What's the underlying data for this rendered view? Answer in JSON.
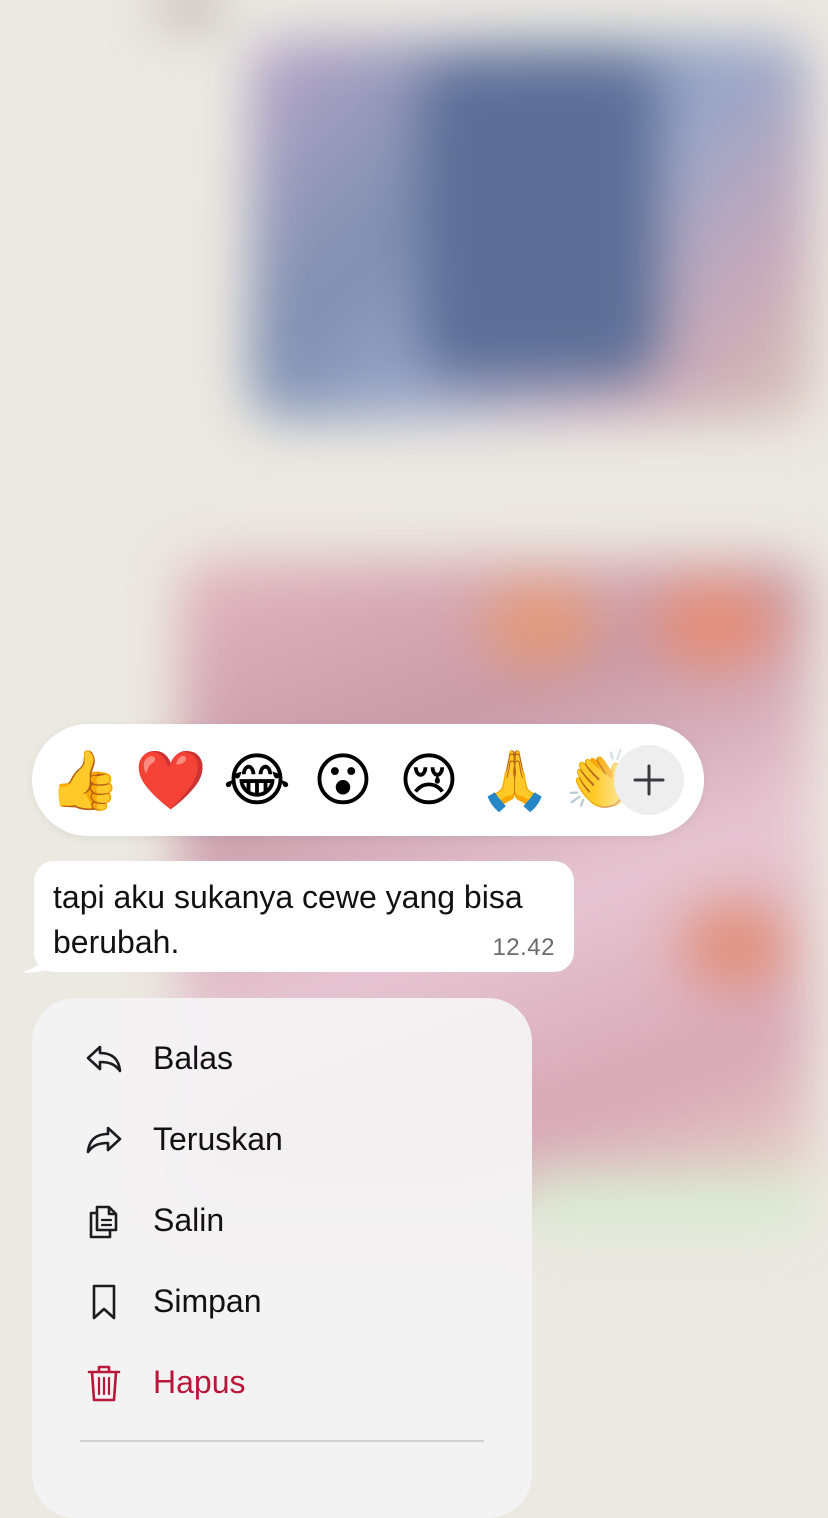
{
  "reaction_bar": {
    "emojis": [
      {
        "glyph": "👍",
        "name": "thumbs-up"
      },
      {
        "glyph": "❤️",
        "name": "red-heart"
      },
      {
        "glyph": "😂",
        "name": "tears-of-joy"
      },
      {
        "glyph": "😮",
        "name": "surprised-face"
      },
      {
        "glyph": "😢",
        "name": "crying-face"
      },
      {
        "glyph": "🙏",
        "name": "folded-hands"
      },
      {
        "glyph": "👏",
        "name": "clapping-hands"
      }
    ],
    "add_icon": "plus-icon"
  },
  "message": {
    "text": "tapi aku sukanya cewe yang bisa berubah.",
    "time": "12.42"
  },
  "menu": {
    "items": [
      {
        "label": "Balas",
        "icon": "reply-icon"
      },
      {
        "label": "Teruskan",
        "icon": "forward-icon"
      },
      {
        "label": "Salin",
        "icon": "copy-icon"
      },
      {
        "label": "Simpan",
        "icon": "bookmark-icon"
      },
      {
        "label": "Hapus",
        "icon": "trash-icon"
      }
    ],
    "danger_color": "#b8173a"
  }
}
